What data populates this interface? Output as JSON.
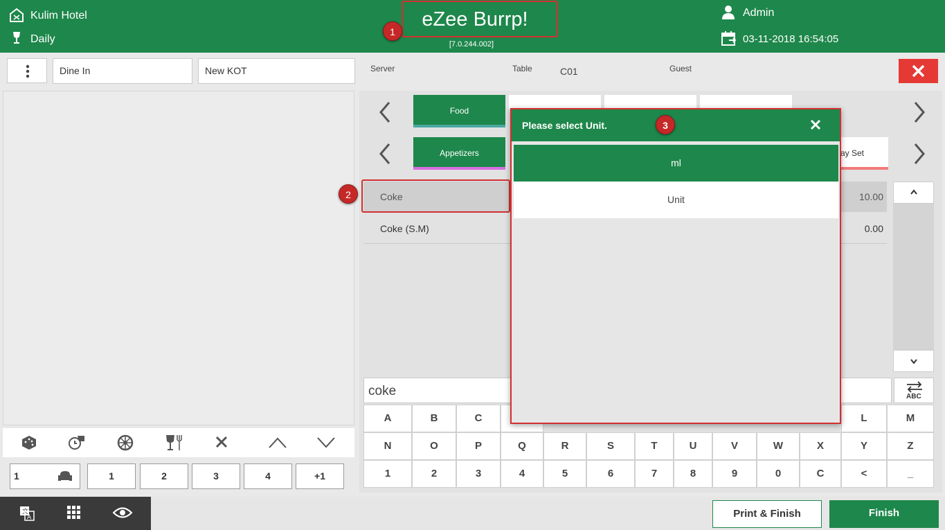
{
  "header": {
    "hotel": "Kulim Hotel",
    "period": "Daily",
    "app_name": "eZee Burrp!",
    "version": "[7.0.244.002]",
    "user": "Admin",
    "datetime": "03-11-2018 16:54:05",
    "color": "#1e874b"
  },
  "callouts": [
    "1",
    "2",
    "3"
  ],
  "toolbar": {
    "order_type": "Dine In",
    "kot": "New KOT",
    "server_label": "Server",
    "table_label": "Table",
    "table_value": "C01",
    "guest_label": "Guest"
  },
  "left_icons": [
    "dice-icon",
    "timer-icon",
    "wheel-icon",
    "wine-fork-icon",
    "delete-icon",
    "up-icon",
    "down-icon"
  ],
  "seat_buttons": [
    "1",
    "1",
    "2",
    "3",
    "4",
    "+1"
  ],
  "categories": {
    "top": [
      "Food",
      "",
      "",
      ""
    ],
    "sub": [
      "Appetizers"
    ],
    "sub_right_partial": "ay Set"
  },
  "items": [
    {
      "name": "Coke",
      "price": "10.00"
    },
    {
      "name": "Coke (S.M)",
      "price": "0.00"
    }
  ],
  "search": {
    "value": "coke"
  },
  "keyboard": {
    "row1": [
      "A",
      "B",
      "C",
      "",
      "",
      "",
      "",
      "",
      "",
      "",
      "",
      "L",
      "M"
    ],
    "row2": [
      "N",
      "O",
      "P",
      "Q",
      "R",
      "S",
      "T",
      "U",
      "V",
      "W",
      "X",
      "Y",
      "Z"
    ],
    "row3": [
      "1",
      "2",
      "3",
      "4",
      "5",
      "6",
      "7",
      "8",
      "9",
      "0",
      "C",
      "<",
      "_"
    ],
    "toggle_label": "ABC"
  },
  "modal": {
    "title": "Please select Unit.",
    "options": [
      "ml",
      "Unit"
    ],
    "selected": "ml"
  },
  "footer": {
    "print_finish": "Print & Finish",
    "finish": "Finish"
  }
}
